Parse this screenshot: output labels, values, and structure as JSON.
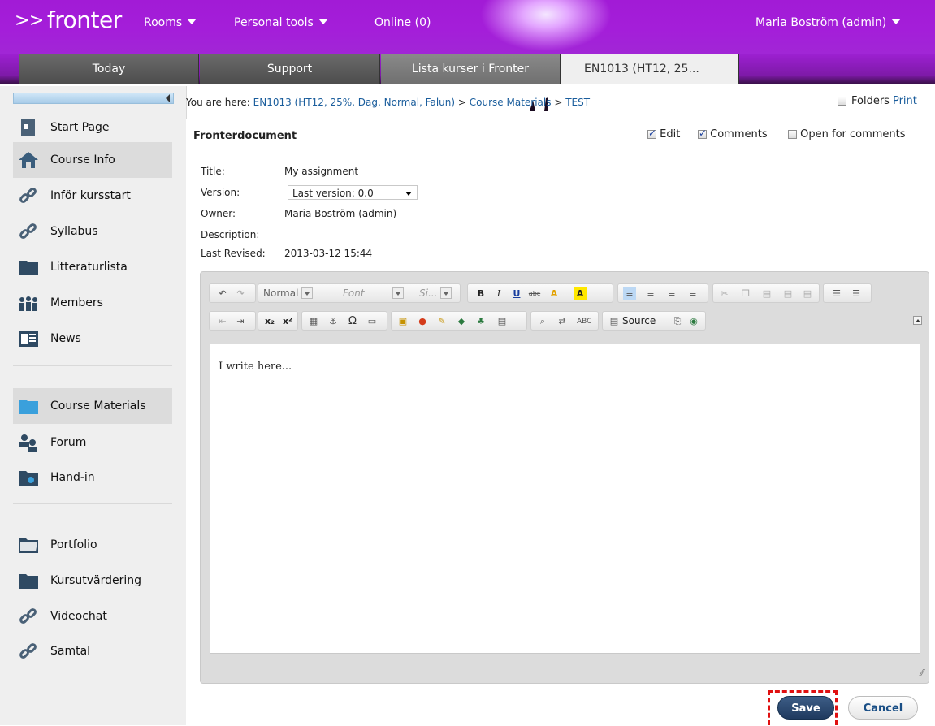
{
  "top": {
    "logo": "fronter",
    "logo_arrows": ">>",
    "nav": {
      "rooms": "Rooms",
      "personal_tools": "Personal tools",
      "online": "Online (0)"
    },
    "user": "Maria Boström (admin)"
  },
  "tabs": [
    "Today",
    "Support",
    "Lista kurser i Fronter",
    "EN1013 (HT12, 25..."
  ],
  "sidebar": {
    "items": [
      {
        "label": "Start Page",
        "icon": "start-page-icon"
      },
      {
        "label": "Course Info",
        "icon": "home-icon"
      },
      {
        "label": "Inför kursstart",
        "icon": "link-icon"
      },
      {
        "label": "Syllabus",
        "icon": "link-icon"
      },
      {
        "label": "Litteraturlista",
        "icon": "folder-icon"
      },
      {
        "label": "Members",
        "icon": "members-icon"
      },
      {
        "label": "News",
        "icon": "news-icon"
      },
      {
        "label": "Course Materials",
        "icon": "folder-open-icon"
      },
      {
        "label": "Forum",
        "icon": "forum-icon"
      },
      {
        "label": "Hand-in",
        "icon": "hand-in-icon"
      },
      {
        "label": "Portfolio",
        "icon": "portfolio-icon"
      },
      {
        "label": "Kursutvärdering",
        "icon": "folder-icon"
      },
      {
        "label": "Videochat",
        "icon": "link-icon"
      },
      {
        "label": "Samtal",
        "icon": "link-icon"
      }
    ]
  },
  "breadcrumb": {
    "label": "You are here:",
    "items": [
      "EN1013 (HT12, 25%, Dag, Normal, Falun)",
      "Course Materials",
      "TEST"
    ],
    "separator": ">"
  },
  "view_opts": {
    "folders": "Folders",
    "print": "Print"
  },
  "document": {
    "heading": "Fronterdocument",
    "options": {
      "edit": "Edit",
      "comments": "Comments",
      "open_for_comments": "Open for comments"
    },
    "fields": {
      "title_label": "Title:",
      "title_value": "My assignment",
      "version_label": "Version:",
      "version_value": "Last version: 0.0",
      "owner_label": "Owner:",
      "owner_value": "Maria Boström (admin)",
      "description_label": "Description:",
      "last_revised_label": "Last Revised:",
      "last_revised_value": "2013-03-12 15:44"
    }
  },
  "editor": {
    "format_combo": "Normal",
    "font_combo": "Font",
    "size_combo": "Si...",
    "source_label": "Source",
    "content": "I write here..."
  },
  "buttons": {
    "save": "Save",
    "cancel": "Cancel"
  },
  "colors": {
    "brand_purple": "#a21bd6",
    "link": "#1a5d9c",
    "save_bg": "#1f3a5f",
    "highlight": "#e01010"
  }
}
